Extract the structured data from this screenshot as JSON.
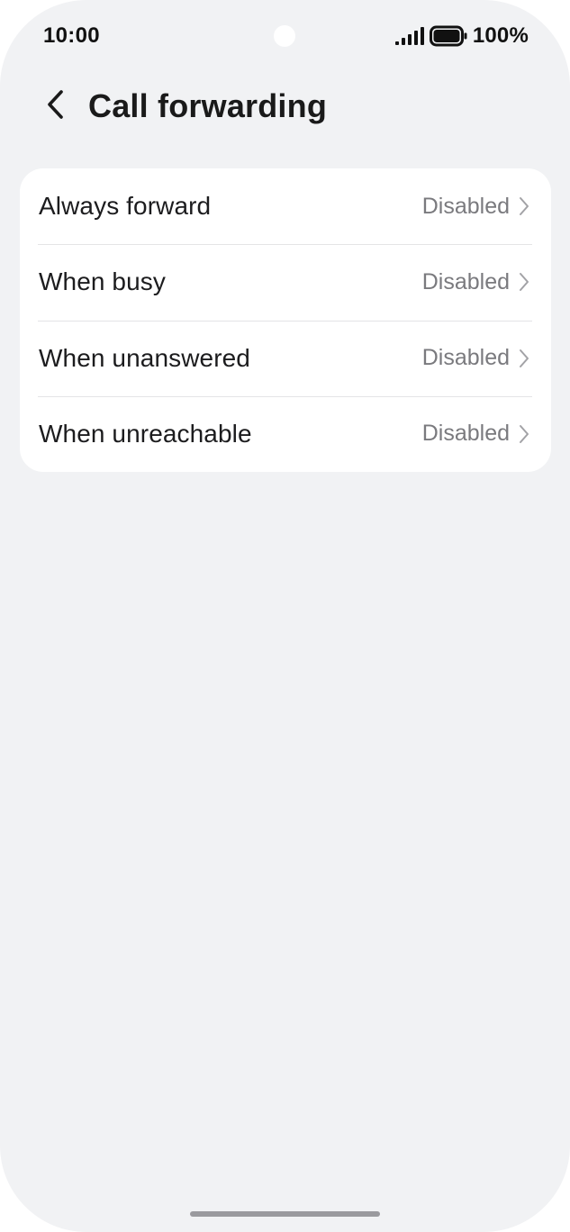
{
  "status_bar": {
    "time": "10:00",
    "battery": "100%",
    "icons": [
      "signal-icon",
      "battery-icon"
    ]
  },
  "header": {
    "back_icon": "chevron-left-icon",
    "title": "Call forwarding"
  },
  "options": [
    {
      "label": "Always forward",
      "value": "Disabled"
    },
    {
      "label": "When busy",
      "value": "Disabled"
    },
    {
      "label": "When unanswered",
      "value": "Disabled"
    },
    {
      "label": "When unreachable",
      "value": "Disabled"
    }
  ],
  "colors": {
    "background": "#f1f2f4",
    "card": "#ffffff",
    "primary_text": "#1c1c1e",
    "secondary_text": "#7a7a7e",
    "divider": "#e4e4e6"
  }
}
